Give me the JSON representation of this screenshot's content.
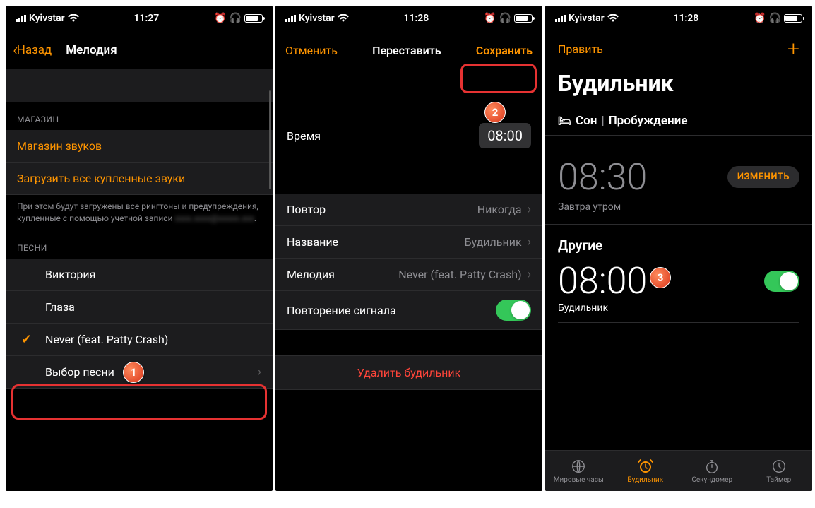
{
  "carrier": "Kyivstar",
  "time1": "11:27",
  "time2": "11:28",
  "time3": "11:28",
  "screen1": {
    "back": "Назад",
    "title": "Мелодия",
    "store_header": "МАГАЗИН",
    "store_link": "Магазин звуков",
    "download_link": "Загрузить все купленные звуки",
    "footer": "При этом будут загружены все рингтоны и предупреждения, купленные с помощью учетной записи",
    "songs_header": "ПЕСНИ",
    "songs": [
      "Виктория",
      "Глаза",
      "Never (feat. Patty Crash)",
      "Выбор песни"
    ]
  },
  "screen2": {
    "cancel": "Отменить",
    "title": "Переставить",
    "save": "Сохранить",
    "time_label": "Время",
    "time_value": "08:00",
    "repeat_label": "Повтор",
    "repeat_value": "Никогда",
    "name_label": "Название",
    "name_value": "Будильник",
    "sound_label": "Мелодия",
    "sound_value": "Never (feat. Patty Crash)",
    "snooze_label": "Повторение сигнала",
    "delete": "Удалить будильник"
  },
  "screen3": {
    "edit": "Править",
    "title": "Будильник",
    "sleep": "Сон",
    "wake": "Пробуждение",
    "alarm1_time": "08:30",
    "change": "ИЗМЕНИТЬ",
    "tomorrow": "Завтра утром",
    "other": "Другие",
    "alarm2_time": "08:00",
    "alarm2_label": "Будильник",
    "tabs": [
      "Мировые часы",
      "Будильник",
      "Секундомер",
      "Таймер"
    ]
  },
  "callouts": {
    "c1": "1",
    "c2": "2",
    "c3": "3"
  }
}
